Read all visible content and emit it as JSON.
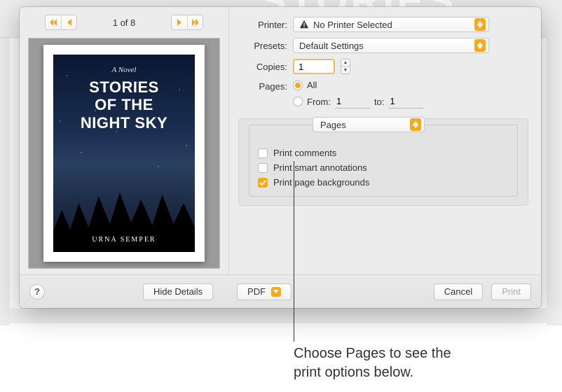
{
  "bg": {
    "ghost_word": "STORIES"
  },
  "preview": {
    "page_counter": "1 of 8",
    "cover": {
      "subtitle": "A Novel",
      "title": "STORIES\nOF THE\nNIGHT SKY",
      "author": "URNA SEMPER"
    }
  },
  "printer": {
    "label": "Printer:",
    "value": "No Printer Selected"
  },
  "presets": {
    "label": "Presets:",
    "value": "Default Settings"
  },
  "copies": {
    "label": "Copies:",
    "value": "1"
  },
  "pages": {
    "label": "Pages:",
    "all_label": "All",
    "from_label": "From:",
    "from_value": "1",
    "to_label": "to:",
    "to_value": "1"
  },
  "app_options": {
    "section_label": "Pages",
    "print_comments": {
      "label": "Print comments",
      "checked": false
    },
    "print_smart_annotations": {
      "label": "Print smart annotations",
      "checked": false
    },
    "print_page_backgrounds": {
      "label": "Print page backgrounds",
      "checked": true
    }
  },
  "footer": {
    "help": "?",
    "hide_details": "Hide Details",
    "pdf": "PDF",
    "cancel": "Cancel",
    "print": "Print"
  },
  "callout": "Choose Pages to see the\nprint options below."
}
